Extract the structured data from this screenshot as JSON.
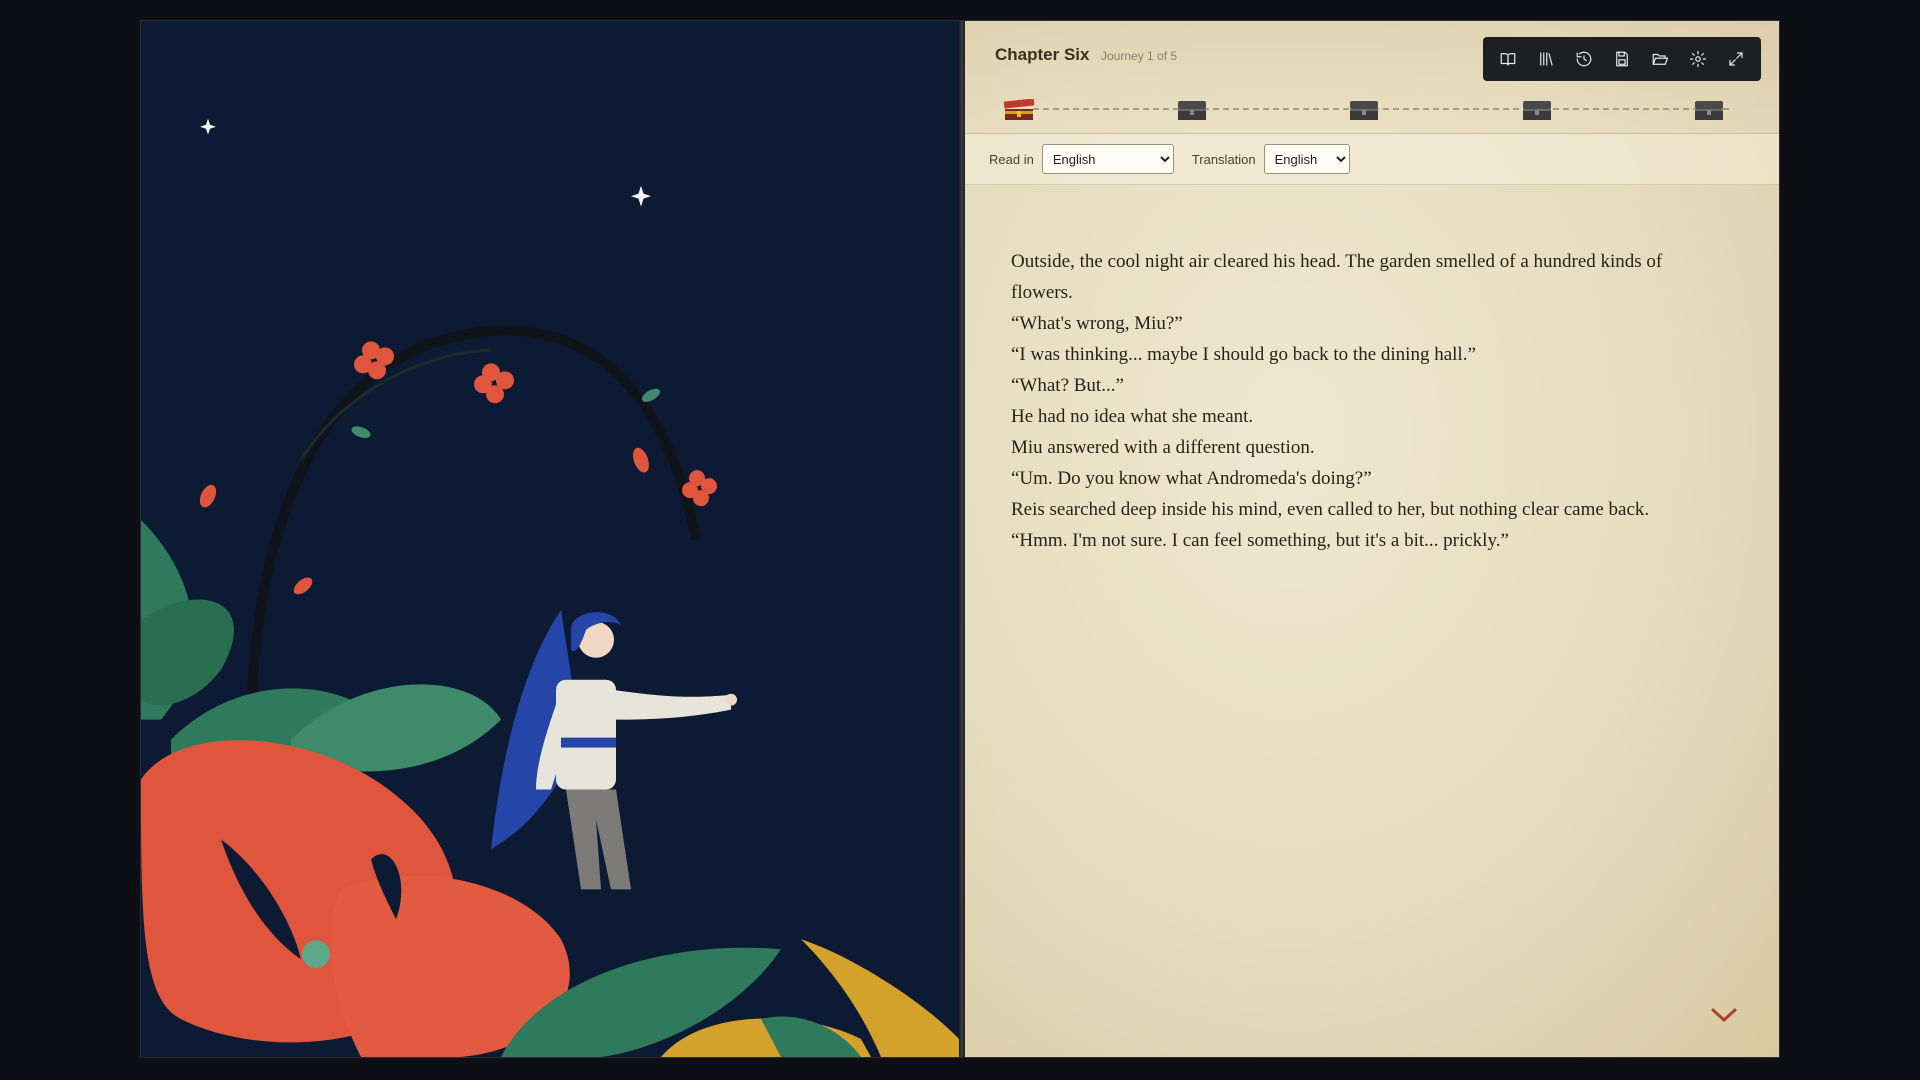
{
  "header": {
    "chapter_title": "Chapter Six",
    "journey": "Journey 1 of 5"
  },
  "progress": {
    "current": 1,
    "total": 5,
    "chests": [
      "open",
      "closed",
      "closed",
      "closed",
      "closed"
    ]
  },
  "toolbar": {
    "icons": [
      "book-icon",
      "library-icon",
      "history-icon",
      "save-icon",
      "folder-open-icon",
      "settings-icon",
      "fullscreen-icon"
    ]
  },
  "language": {
    "read_in_label": "Read in",
    "read_in_value": "English",
    "translation_label": "Translation",
    "translation_value": "English"
  },
  "story": {
    "paragraphs": [
      "Outside, the cool night air cleared his head. The garden smelled of a hundred kinds of flowers.",
      "“What's wrong, Miu?”",
      "“I was thinking... maybe I should go back to the dining hall.”",
      "“What? But...”",
      "He had no idea what she meant.",
      "Miu answered with a different question.",
      "“Um. Do you know what Andromeda's doing?”",
      "Reis searched deep inside his mind, even called to her, but nothing clear came back.",
      "“Hmm. I'm not sure. I can feel something, but it's a bit... prickly.”"
    ]
  },
  "colors": {
    "night_sky": "#0c1a33",
    "flower_red": "#e0553d",
    "leaf_green": "#2f7a5c",
    "leaf_gold": "#d4a12a",
    "cloak_blue": "#2545a8",
    "accent_chevron": "#a8432e"
  }
}
